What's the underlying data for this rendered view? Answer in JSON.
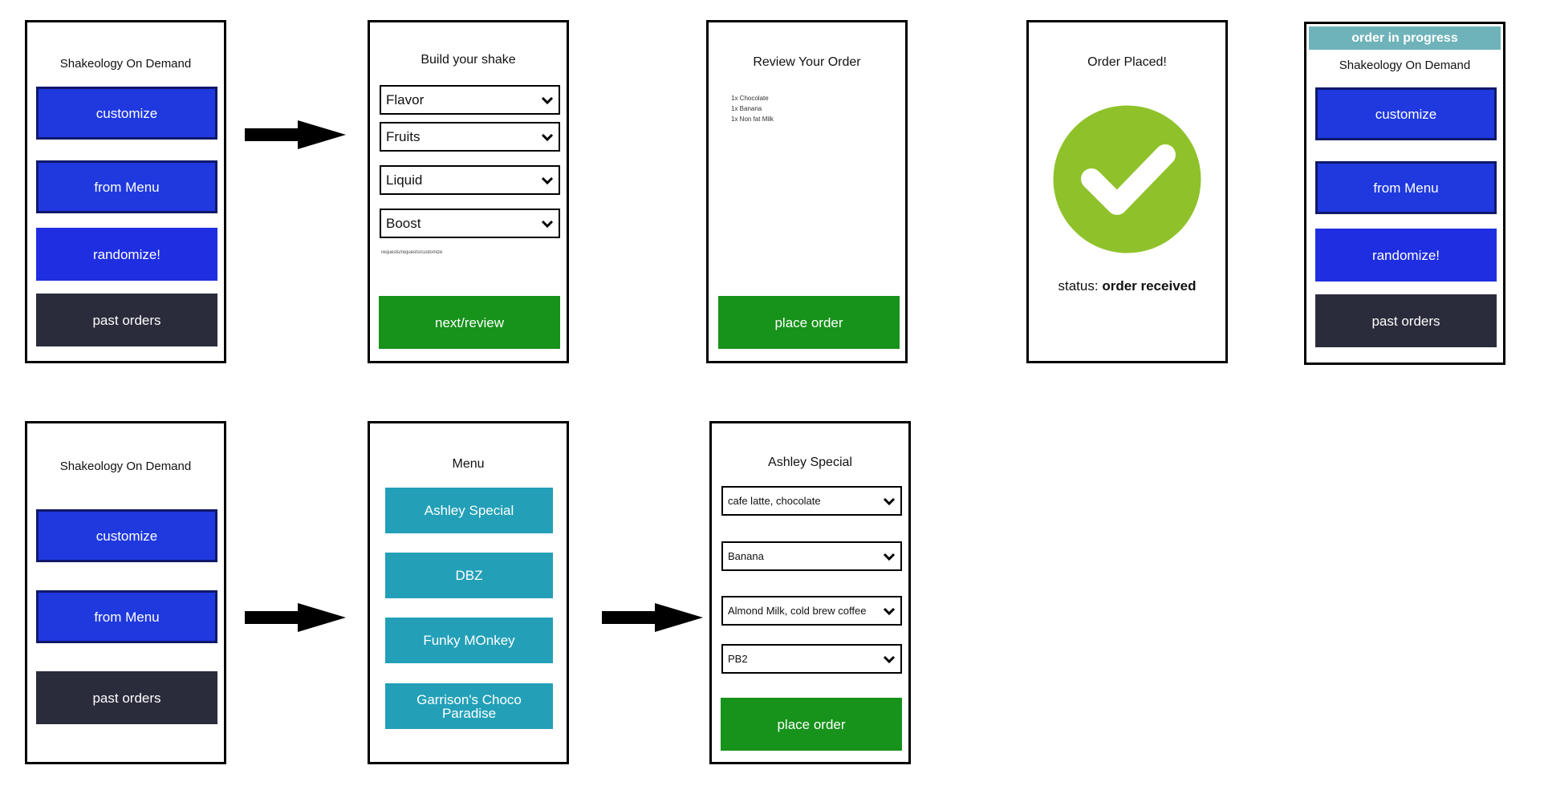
{
  "app_name": "Shakeology On Demand",
  "home": {
    "buttons": {
      "customize": "customize",
      "from_menu": "from Menu",
      "randomize": "randomize!",
      "past_orders": "past orders"
    }
  },
  "build": {
    "title": "Build your shake",
    "dropdowns": [
      "Flavor",
      "Fruits",
      "Liquid",
      "Boost"
    ],
    "fine_print": "requests/requests/customize",
    "next_button": "next/review"
  },
  "review": {
    "title": "Review Your Order",
    "items": [
      "1x Chocolate",
      "1x Banana",
      "1x Non fat Milk"
    ],
    "place_order": "place order"
  },
  "placed": {
    "title": "Order Placed!",
    "status_label": "status:",
    "status_value": "order received"
  },
  "in_progress": {
    "banner": "order in progress"
  },
  "menu": {
    "title": "Menu",
    "items": [
      "Ashley Special",
      "DBZ",
      "Funky MOnkey",
      "Garrison's Choco Paradise"
    ]
  },
  "special": {
    "title": "Ashley Special",
    "dropdowns": [
      "cafe latte, chocolate",
      "Banana",
      "Almond Milk, cold brew coffee",
      "PB2"
    ],
    "place_order": "place order"
  },
  "colors": {
    "blue": "#1f39df",
    "dark": "#2a2b3b",
    "green": "#17921b",
    "teal": "#23a0b8",
    "banner": "#6fb3ba",
    "check_green": "#8fc22a"
  }
}
